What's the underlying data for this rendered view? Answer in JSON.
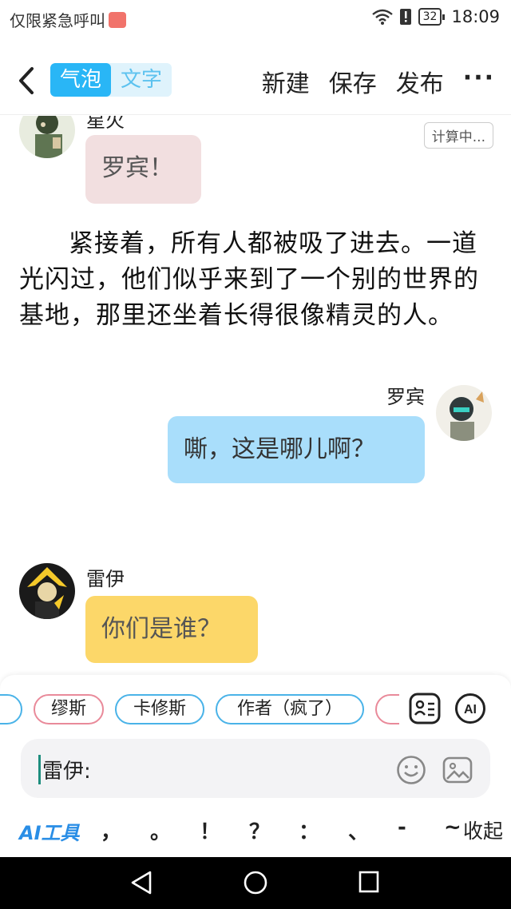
{
  "status": {
    "carrier_text": "仅限紧急呼叫",
    "battery": "32",
    "time": "18:09"
  },
  "header": {
    "toggle_bubble": "气泡",
    "toggle_text": "文字",
    "new_label": "新建",
    "save_label": "保存",
    "publish_label": "发布",
    "more_label": "···"
  },
  "chat": {
    "calc_badge": "计算中...",
    "msg1": {
      "name": "星火",
      "text": "罗宾！"
    },
    "narration": "紧接着，所有人都被吸了进去。一道光闪过，他们似乎来到了一个别的世界的基地，那里还坐着长得很像精灵的人。",
    "msg2": {
      "name": "罗宾",
      "text": "嘶，这是哪儿啊？"
    },
    "msg3": {
      "name": "雷伊",
      "text": "你们是谁？"
    }
  },
  "panel": {
    "chips": [
      "缪斯",
      "卡修斯",
      "作者（疯了）"
    ],
    "input_value": "雷伊:",
    "ai_tools": "AI工具",
    "punctuation": [
      "，",
      "。",
      "！",
      "？",
      "：",
      "、",
      "-",
      "~"
    ],
    "collapse_label": "收起"
  },
  "colors": {
    "accent": "#29b6f6",
    "bubble_pink": "#f2dfe0",
    "bubble_blue": "#a9defb",
    "bubble_yellow": "#fcd769",
    "chip_pink": "#e98a9a",
    "chip_blue": "#4ab3e8"
  }
}
